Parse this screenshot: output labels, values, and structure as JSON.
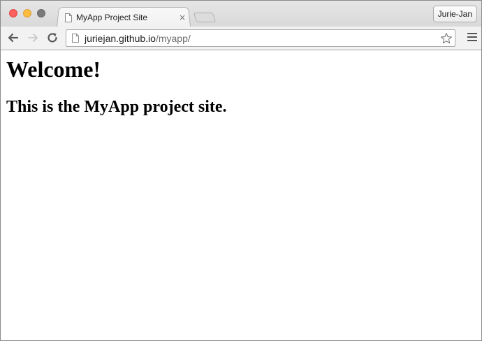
{
  "window": {
    "tab": {
      "title": "MyApp Project Site",
      "close_label": "×"
    },
    "profile": {
      "label": "Jurie-Jan"
    }
  },
  "toolbar": {
    "url": {
      "host": "juriejan.github.io",
      "path": "/myapp/"
    },
    "icons": {
      "back": "back-arrow-icon",
      "forward": "forward-arrow-icon",
      "reload": "reload-icon",
      "page": "page-icon",
      "bookmark": "star-icon",
      "menu": "hamburger-menu-icon"
    }
  },
  "page": {
    "heading": "Welcome!",
    "subheading": "This is the MyApp project site."
  },
  "colors": {
    "close_light": "#fc615d",
    "minimize_light": "#fdbc40",
    "zoom_light": "#7a7a7a"
  }
}
